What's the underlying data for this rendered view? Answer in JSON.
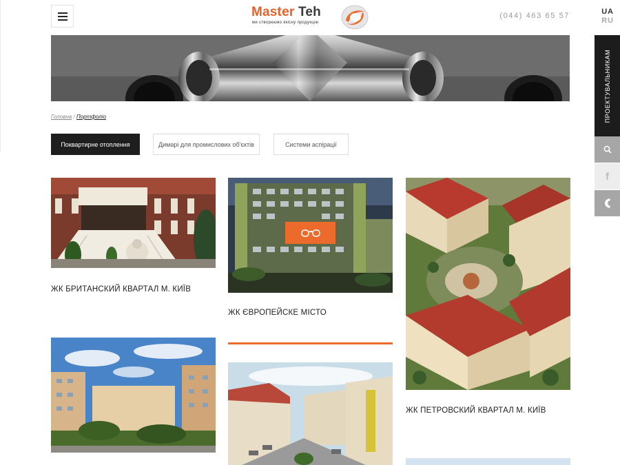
{
  "header": {
    "logo_word1": "Master",
    "logo_word2": "Teh",
    "logo_tagline": "ми створюємо якісну продукцію",
    "phone": "(044) 463 65 57",
    "lang_active": "UA",
    "lang_other": "RU"
  },
  "side": {
    "tab_label": "ПРОЕКТУВАЛЬНИКАМ",
    "facebook_glyph": "f"
  },
  "breadcrumb": {
    "home": "Головна",
    "separator": "/",
    "current": "Портфоліо"
  },
  "filters": [
    {
      "label": "Поквартирне отоплення",
      "active": true
    },
    {
      "label": "Димарі для промислових об'єктів",
      "active": false
    },
    {
      "label": "Системи аспірації",
      "active": false
    }
  ],
  "projects": [
    {
      "title": "ЖК БРИТАНСКИЙ КВАРТАЛ М. КИЇВ"
    },
    {
      "title": "ЖК ЄВРОПЕЙСКЕ МІСТО"
    },
    {
      "title": "ЖК ПЕТРОВСКИЙ КВАРТАЛ М. КИЇВ"
    }
  ],
  "colors": {
    "accent": "#ec6a2c",
    "dark": "#1e1e1e",
    "side_gray": "#a6a6a6"
  },
  "icons": [
    "menu-icon",
    "logo-swirl-icon",
    "search-icon",
    "facebook-icon",
    "phone-icon",
    "glasses-icon"
  ]
}
